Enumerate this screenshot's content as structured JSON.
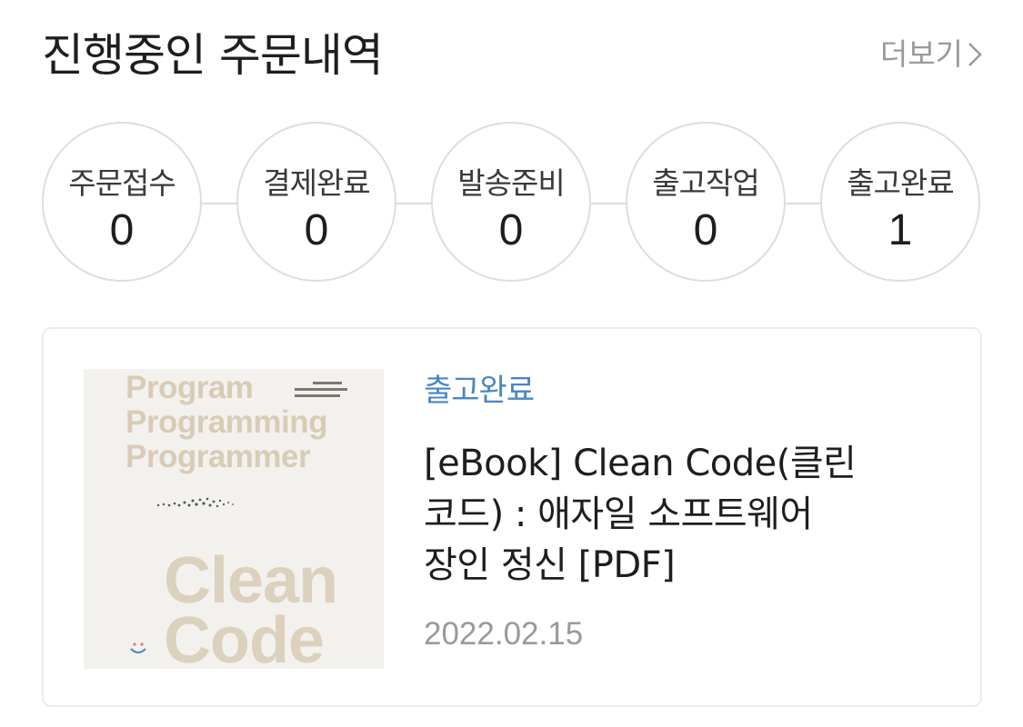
{
  "header": {
    "title": "진행중인 주문내역",
    "more_label": "더보기",
    "more_icon": "chevron-right-icon"
  },
  "steps": [
    {
      "label": "주문접수",
      "count": "0"
    },
    {
      "label": "결제완료",
      "count": "0"
    },
    {
      "label": "발송준비",
      "count": "0"
    },
    {
      "label": "출고작업",
      "count": "0"
    },
    {
      "label": "출고완료",
      "count": "1"
    }
  ],
  "order": {
    "status": "출고완료",
    "title": "[eBook] Clean Code(클린\n코드) : 애자일 소프트웨어\n장인 정신 [PDF]",
    "date": "2022.02.15",
    "cover": {
      "lines": [
        "Program",
        "Programming",
        "Programmer"
      ],
      "words": [
        "Clean",
        "Code"
      ]
    }
  },
  "colors": {
    "status_accent": "#4a86c2",
    "muted_text": "#9a9a9a",
    "border": "#dedede"
  }
}
